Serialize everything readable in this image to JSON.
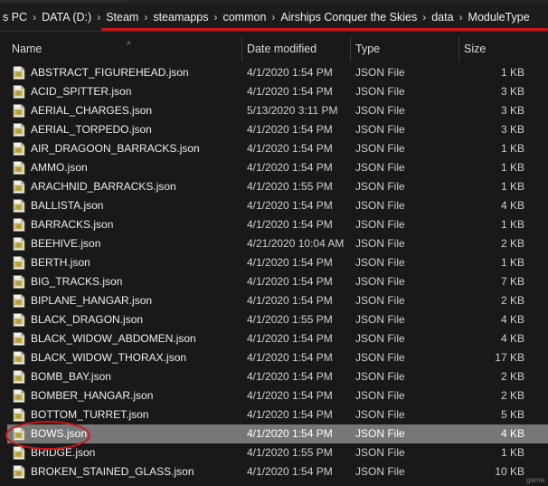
{
  "breadcrumb": [
    "s PC",
    "DATA (D:)",
    "Steam",
    "steamapps",
    "common",
    "Airships Conquer the Skies",
    "data",
    "ModuleType"
  ],
  "columns": {
    "name": "Name",
    "date": "Date modified",
    "type": "Type",
    "size": "Size"
  },
  "files": [
    {
      "name": "ABSTRACT_FIGUREHEAD.json",
      "date": "4/1/2020 1:54 PM",
      "type": "JSON File",
      "size": "1 KB"
    },
    {
      "name": "ACID_SPITTER.json",
      "date": "4/1/2020 1:54 PM",
      "type": "JSON File",
      "size": "3 KB"
    },
    {
      "name": "AERIAL_CHARGES.json",
      "date": "5/13/2020 3:11 PM",
      "type": "JSON File",
      "size": "3 KB"
    },
    {
      "name": "AERIAL_TORPEDO.json",
      "date": "4/1/2020 1:54 PM",
      "type": "JSON File",
      "size": "3 KB"
    },
    {
      "name": "AIR_DRAGOON_BARRACKS.json",
      "date": "4/1/2020 1:54 PM",
      "type": "JSON File",
      "size": "1 KB"
    },
    {
      "name": "AMMO.json",
      "date": "4/1/2020 1:54 PM",
      "type": "JSON File",
      "size": "1 KB"
    },
    {
      "name": "ARACHNID_BARRACKS.json",
      "date": "4/1/2020 1:55 PM",
      "type": "JSON File",
      "size": "1 KB"
    },
    {
      "name": "BALLISTA.json",
      "date": "4/1/2020 1:54 PM",
      "type": "JSON File",
      "size": "4 KB"
    },
    {
      "name": "BARRACKS.json",
      "date": "4/1/2020 1:54 PM",
      "type": "JSON File",
      "size": "1 KB"
    },
    {
      "name": "BEEHIVE.json",
      "date": "4/21/2020 10:04 AM",
      "type": "JSON File",
      "size": "2 KB"
    },
    {
      "name": "BERTH.json",
      "date": "4/1/2020 1:54 PM",
      "type": "JSON File",
      "size": "1 KB"
    },
    {
      "name": "BIG_TRACKS.json",
      "date": "4/1/2020 1:54 PM",
      "type": "JSON File",
      "size": "7 KB"
    },
    {
      "name": "BIPLANE_HANGAR.json",
      "date": "4/1/2020 1:54 PM",
      "type": "JSON File",
      "size": "2 KB"
    },
    {
      "name": "BLACK_DRAGON.json",
      "date": "4/1/2020 1:55 PM",
      "type": "JSON File",
      "size": "4 KB"
    },
    {
      "name": "BLACK_WIDOW_ABDOMEN.json",
      "date": "4/1/2020 1:54 PM",
      "type": "JSON File",
      "size": "4 KB"
    },
    {
      "name": "BLACK_WIDOW_THORAX.json",
      "date": "4/1/2020 1:54 PM",
      "type": "JSON File",
      "size": "17 KB"
    },
    {
      "name": "BOMB_BAY.json",
      "date": "4/1/2020 1:54 PM",
      "type": "JSON File",
      "size": "2 KB"
    },
    {
      "name": "BOMBER_HANGAR.json",
      "date": "4/1/2020 1:54 PM",
      "type": "JSON File",
      "size": "2 KB"
    },
    {
      "name": "BOTTOM_TURRET.json",
      "date": "4/1/2020 1:54 PM",
      "type": "JSON File",
      "size": "5 KB"
    },
    {
      "name": "BOWS.json",
      "date": "4/1/2020 1:54 PM",
      "type": "JSON File",
      "size": "4 KB",
      "selected": true
    },
    {
      "name": "BRIDGE.json",
      "date": "4/1/2020 1:55 PM",
      "type": "JSON File",
      "size": "1 KB"
    },
    {
      "name": "BROKEN_STAINED_GLASS.json",
      "date": "4/1/2020 1:54 PM",
      "type": "JSON File",
      "size": "10 KB"
    }
  ],
  "colors": {
    "selected_row": "#777777",
    "annotation_red": "#d01212",
    "background": "#191919"
  },
  "icons": {
    "file": "json-file-icon",
    "sort": "sort-up-icon",
    "separator": "chevron-right-icon"
  },
  "watermark": "gamə"
}
